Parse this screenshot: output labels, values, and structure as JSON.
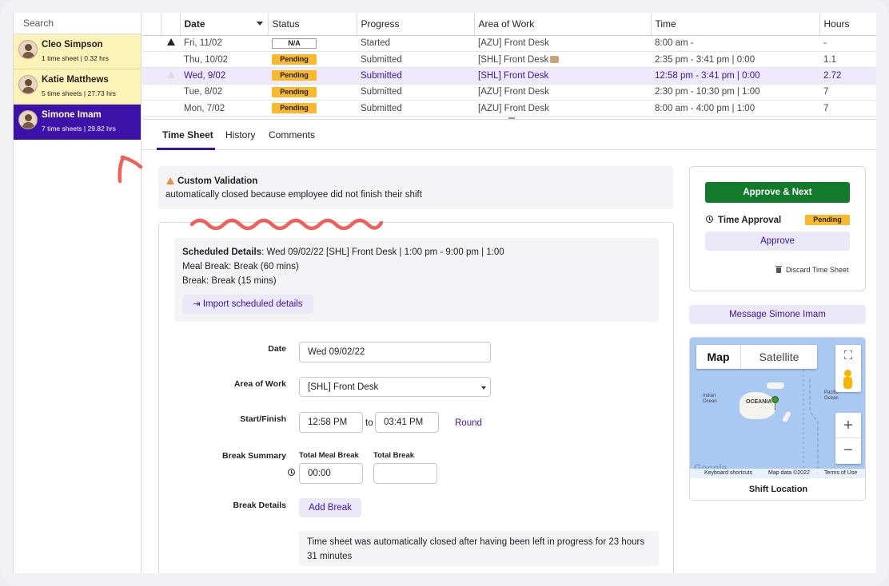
{
  "sidebar": {
    "search_label": "Search",
    "employees": [
      {
        "name": "Cleo Simpson",
        "summary": "1 time sheet | 0.32 hrs"
      },
      {
        "name": "Katie Matthews",
        "summary": "5 time sheets | 27.73 hrs"
      },
      {
        "name": "Simone Imam",
        "summary": "7 time sheets | 29.82 hrs"
      }
    ]
  },
  "table": {
    "headers": {
      "date": "Date",
      "status": "Status",
      "progress": "Progress",
      "area": "Area of Work",
      "time": "Time",
      "hours": "Hours"
    },
    "rows": [
      {
        "date": "Fri, 11/02",
        "status": "N/A",
        "progress": "Started",
        "area": "[AZU] Front Desk",
        "time": "8:00 am -",
        "hours": "-"
      },
      {
        "date": "Thu, 10/02",
        "status": "Pending",
        "progress": "Submitted",
        "area": "[SHL] Front Desk",
        "time": "2:35 pm - 3:41 pm | 0:00",
        "hours": "1.1"
      },
      {
        "date": "Wed, 9/02",
        "status": "Pending",
        "progress": "Submitted",
        "area": "[SHL] Front Desk",
        "time": "12:58 pm - 3:41 pm | 0:00",
        "hours": "2.72"
      },
      {
        "date": "Tue, 8/02",
        "status": "Pending",
        "progress": "Submitted",
        "area": "[AZU] Front Desk",
        "time": "2:30 pm - 10:30 pm | 1:00",
        "hours": "7"
      },
      {
        "date": "Mon, 7/02",
        "status": "Pending",
        "progress": "Submitted",
        "area": "[AZU] Front Desk",
        "time": "8:00 am - 4:00 pm | 1:00",
        "hours": "7"
      }
    ]
  },
  "tabs": {
    "timesheet": "Time Sheet",
    "history": "History",
    "comments": "Comments"
  },
  "validation": {
    "title": "Custom Validation",
    "message": "automatically closed because employee did not finish their shift"
  },
  "schedule": {
    "label": "Scheduled Details",
    "details": ": Wed 09/02/22 [SHL] Front Desk | 1:00 pm - 9:00 pm | 1:00",
    "meal_break": "Meal Break: Break (60 mins)",
    "break": "Break: Break (15 mins)",
    "import_label": "Import scheduled details"
  },
  "form": {
    "date_label": "Date",
    "date_value": "Wed 09/02/22",
    "area_label": "Area of Work",
    "area_value": "[SHL] Front Desk",
    "startfinish_label": "Start/Finish",
    "start_value": "12:58 PM",
    "to_label": "to",
    "finish_value": "03:41 PM",
    "round_label": "Round",
    "break_summary_label": "Break Summary",
    "total_meal_label": "Total Meal Break",
    "total_break_label": "Total Break",
    "meal_value": "00:00",
    "break_value": "",
    "break_details_label": "Break Details",
    "add_break_label": "Add Break",
    "note": "Time sheet was automatically closed after having been left in progress for 23 hours 31 minutes"
  },
  "approval": {
    "approve_next": "Approve & Next",
    "time_approval_label": "Time Approval",
    "status": "Pending",
    "approve": "Approve",
    "discard": "Discard Time Sheet",
    "message": "Message Simone Imam"
  },
  "map": {
    "map_tab": "Map",
    "satellite_tab": "Satellite",
    "indian_ocean": "Indian\nOcean",
    "oceania": "OCEANIA",
    "pacific": "Pacific\nOcean",
    "keyboard": "Keyboard shortcuts",
    "map_data": "Map data ©2022",
    "terms": "Terms of Use",
    "caption": "Shift Location",
    "google": "Google"
  },
  "colors": {
    "accent": "#3d12a8",
    "pending": "#f8b92d",
    "approve_green": "#137a2c",
    "annotation": "#f0605a"
  }
}
